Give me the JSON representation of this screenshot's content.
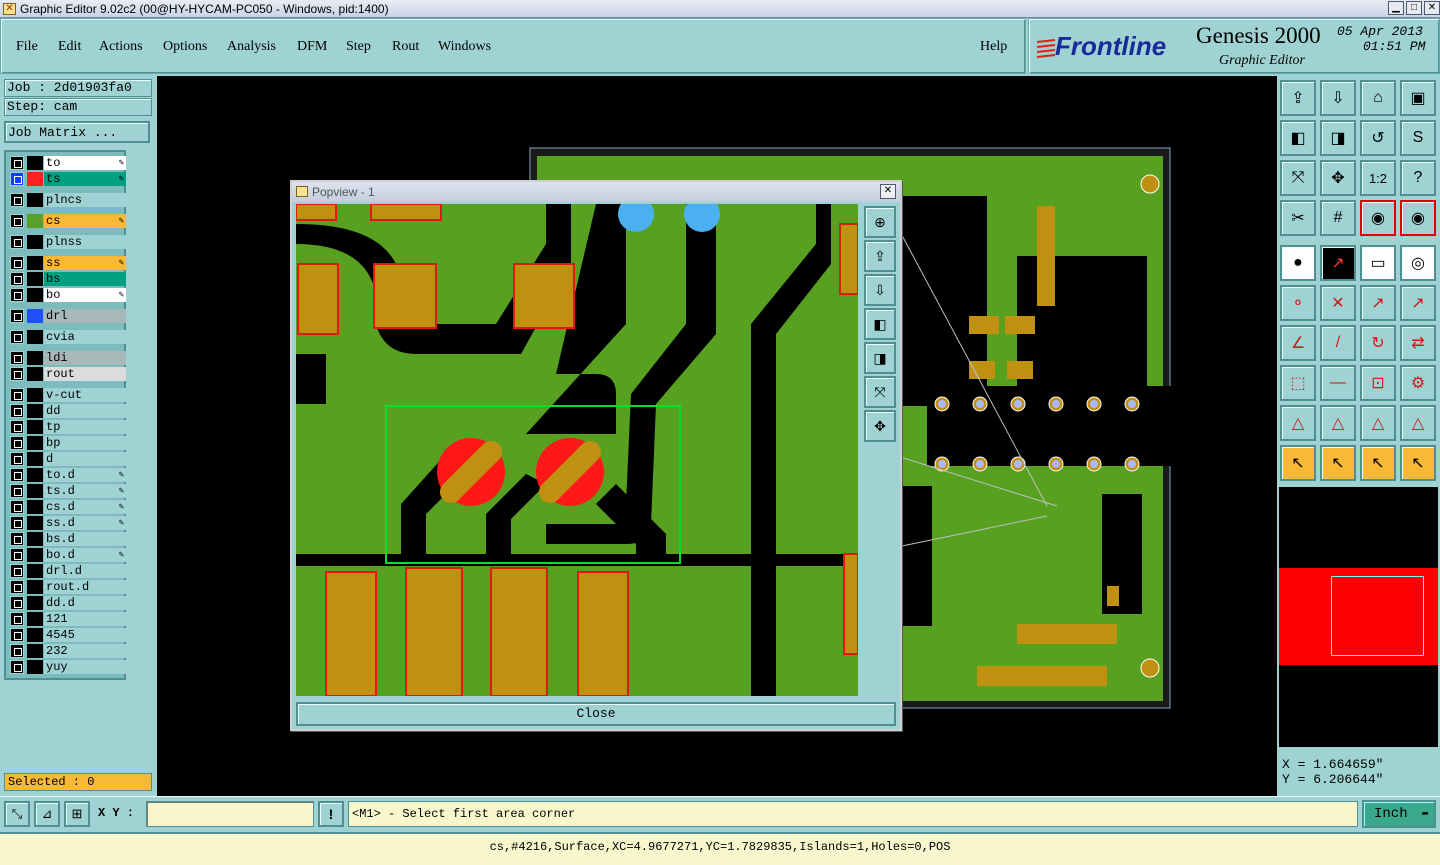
{
  "titlebar": {
    "title": "Graphic Editor 9.02c2 (00@HY-HYCAM-PC050 - Windows, pid:1400)",
    "min": "▁",
    "max": "□",
    "close": "✕"
  },
  "menu": {
    "items": [
      "File",
      "Edit",
      "Actions",
      "Options",
      "Analysis",
      "DFM",
      "Step",
      "Rout",
      "Windows"
    ],
    "help": "Help"
  },
  "brand": {
    "logo": "Frontline",
    "product": "Genesis 2000",
    "subtitle": "Graphic Editor",
    "date": "05 Apr 2013",
    "time": "01:51 PM"
  },
  "job": {
    "job_label": "Job : 2d01903fa0",
    "step_label": "Step: cam",
    "matrix_button": "Job Matrix ..."
  },
  "layers": [
    {
      "name": "to",
      "color": "#ffffff",
      "edit": true,
      "swatch": ""
    },
    {
      "name": "ts",
      "color": "#00a080",
      "edit": true,
      "swatch": "#ff2020",
      "active": true
    },
    {
      "name": "plncs",
      "color": "#9fd2d2",
      "edit": false,
      "swatch": ""
    },
    {
      "name": "cs",
      "color": "#f8b838",
      "edit": true,
      "swatch": "#5aa028"
    },
    {
      "name": "plnss",
      "color": "#9fd2d2",
      "edit": false,
      "swatch": ""
    },
    {
      "name": "ss",
      "color": "#f8b838",
      "edit": true,
      "swatch": ""
    },
    {
      "name": "bs",
      "color": "#00a080",
      "edit": false,
      "swatch": ""
    },
    {
      "name": "bo",
      "color": "#ffffff",
      "edit": true,
      "swatch": ""
    },
    {
      "name": "drl",
      "color": "#a8b8b8",
      "edit": false,
      "swatch": "#2050ff"
    },
    {
      "name": "cvia",
      "color": "#9fd2d2",
      "edit": false,
      "swatch": ""
    },
    {
      "name": "ldi",
      "color": "#a8b8b8",
      "edit": false,
      "swatch": ""
    },
    {
      "name": "rout",
      "color": "#dcdcdc",
      "edit": false,
      "swatch": ""
    },
    {
      "name": "v-cut",
      "color": "#9fd2d2",
      "edit": false,
      "swatch": ""
    },
    {
      "name": "dd",
      "color": "#9fd2d2",
      "edit": false,
      "swatch": ""
    },
    {
      "name": "tp",
      "color": "#9fd2d2",
      "edit": false,
      "swatch": ""
    },
    {
      "name": "bp",
      "color": "#9fd2d2",
      "edit": false,
      "swatch": ""
    },
    {
      "name": "d",
      "color": "#9fd2d2",
      "edit": false,
      "swatch": ""
    },
    {
      "name": "to.d",
      "color": "#9fd2d2",
      "edit": true,
      "swatch": ""
    },
    {
      "name": "ts.d",
      "color": "#9fd2d2",
      "edit": true,
      "swatch": ""
    },
    {
      "name": "cs.d",
      "color": "#9fd2d2",
      "edit": true,
      "swatch": ""
    },
    {
      "name": "ss.d",
      "color": "#9fd2d2",
      "edit": true,
      "swatch": ""
    },
    {
      "name": "bs.d",
      "color": "#9fd2d2",
      "edit": false,
      "swatch": ""
    },
    {
      "name": "bo.d",
      "color": "#9fd2d2",
      "edit": true,
      "swatch": ""
    },
    {
      "name": "drl.d",
      "color": "#9fd2d2",
      "edit": false,
      "swatch": ""
    },
    {
      "name": "rout.d",
      "color": "#9fd2d2",
      "edit": false,
      "swatch": ""
    },
    {
      "name": "dd.d",
      "color": "#9fd2d2",
      "edit": false,
      "swatch": ""
    },
    {
      "name": "121",
      "color": "#9fd2d2",
      "edit": false,
      "swatch": ""
    },
    {
      "name": "4545",
      "color": "#9fd2d2",
      "edit": false,
      "swatch": ""
    },
    {
      "name": "232",
      "color": "#9fd2d2",
      "edit": false,
      "swatch": ""
    },
    {
      "name": "yuy",
      "color": "#9fd2d2",
      "edit": false,
      "swatch": ""
    }
  ],
  "selected": "Selected : 0",
  "popview": {
    "title": "Popview - 1",
    "close_button": "Close"
  },
  "coords": {
    "x": "X  =  1.664659\"",
    "y": "Y  =  6.206644\""
  },
  "bottom": {
    "xy_label": "X Y :",
    "xy_value": "",
    "prompt": "<M1> - Select first area corner",
    "units": "Inch"
  },
  "status": "cs,#4216,Surface,XC=4.9677271,YC=1.7829835,Islands=1,Holes=0,POS",
  "toolbar_icons": [
    "zoom-home-icon",
    "zoom-window-icon",
    "home-view-icon",
    "split-view-icon",
    "pan-left-icon",
    "pan-right-icon",
    "mirror-icon",
    "s-curve-icon",
    "fit-screen-icon",
    "center-icon",
    "scale-1-2-icon",
    "help-question-icon",
    "measure-icon",
    "grid-icon",
    "snap-red-icon",
    "snap-red-2-icon",
    "add-pad-icon",
    "add-line-icon",
    "ruler-icon",
    "target-icon",
    "connect-icon",
    "cross-icon",
    "move-icon",
    "move-red-icon",
    "angle-icon",
    "slash-icon",
    "rotate-icon",
    "flip-icon",
    "copy-icon",
    "line-minus-icon",
    "resize-icon",
    "merge-icon",
    "triangle-1-icon",
    "triangle-2-icon",
    "triangle-3-icon",
    "triangle-4-icon",
    "select-arrow-icon",
    "select-box-icon",
    "select-snap-icon",
    "select-net-icon"
  ],
  "toolbar_glyphs": [
    "⇪",
    "⇩",
    "⌂",
    "▣",
    "◧",
    "◨",
    "↺",
    "S",
    "⤧",
    "✥",
    "1:2",
    "?",
    "✂",
    "#",
    "◉",
    "◉",
    "●",
    "↗",
    "▭",
    "◎",
    "⚬",
    "✕",
    "↗",
    "↗",
    "∠",
    "/",
    "↻",
    "⇄",
    "⬚",
    "—",
    "⊡",
    "⚙",
    "△",
    "△",
    "△",
    "△",
    "↖",
    "↖",
    "↖",
    "↖"
  ]
}
